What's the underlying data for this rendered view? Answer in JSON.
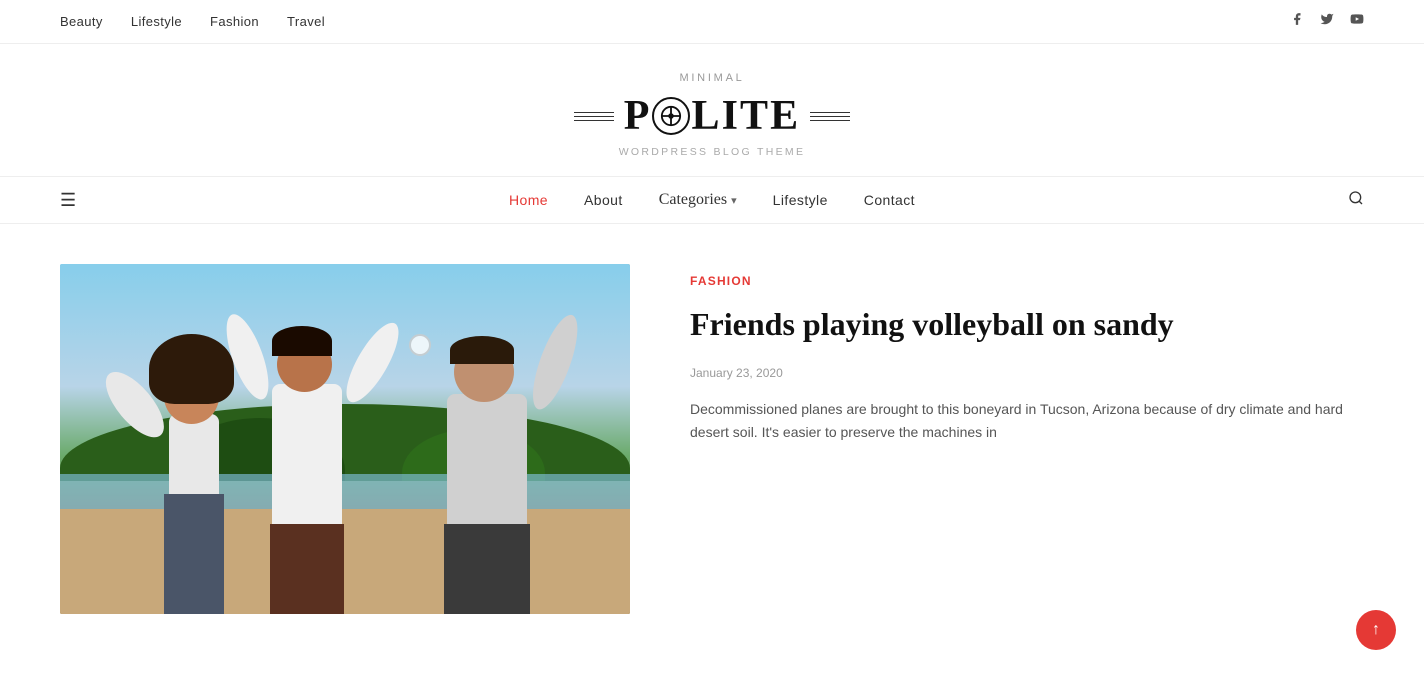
{
  "top_nav": {
    "links": [
      {
        "label": "Beauty",
        "href": "#"
      },
      {
        "label": "Lifestyle",
        "href": "#"
      },
      {
        "label": "Fashion",
        "href": "#"
      },
      {
        "label": "Travel",
        "href": "#"
      }
    ],
    "social": [
      {
        "icon": "facebook-icon",
        "symbol": "f",
        "href": "#"
      },
      {
        "icon": "twitter-icon",
        "symbol": "t",
        "href": "#"
      },
      {
        "icon": "youtube-icon",
        "symbol": "▶",
        "href": "#"
      }
    ]
  },
  "logo": {
    "subtitle_top": "MINIMAL",
    "text_before": "P",
    "icon_symbol": "⊕",
    "text_after": "LITE",
    "full_text": "PÖLITE",
    "subtitle_bottom": "WORDPRESS BLOG THEME"
  },
  "main_nav": {
    "hamburger": "≡",
    "links": [
      {
        "label": "Home",
        "active": true
      },
      {
        "label": "About",
        "active": false
      },
      {
        "label": "Categories",
        "active": false,
        "dropdown": true
      },
      {
        "label": "Lifestyle",
        "active": false
      },
      {
        "label": "Contact",
        "active": false
      }
    ],
    "search_icon": "🔍"
  },
  "article": {
    "category": "Fashion",
    "title": "Friends playing volleyball on sandy",
    "date": "January 23, 2020",
    "excerpt": "Decommissioned planes are brought to this boneyard in Tucson, Arizona because of dry climate and hard desert soil. It's easier to preserve the machines in"
  },
  "scroll_top": {
    "symbol": "↑"
  }
}
